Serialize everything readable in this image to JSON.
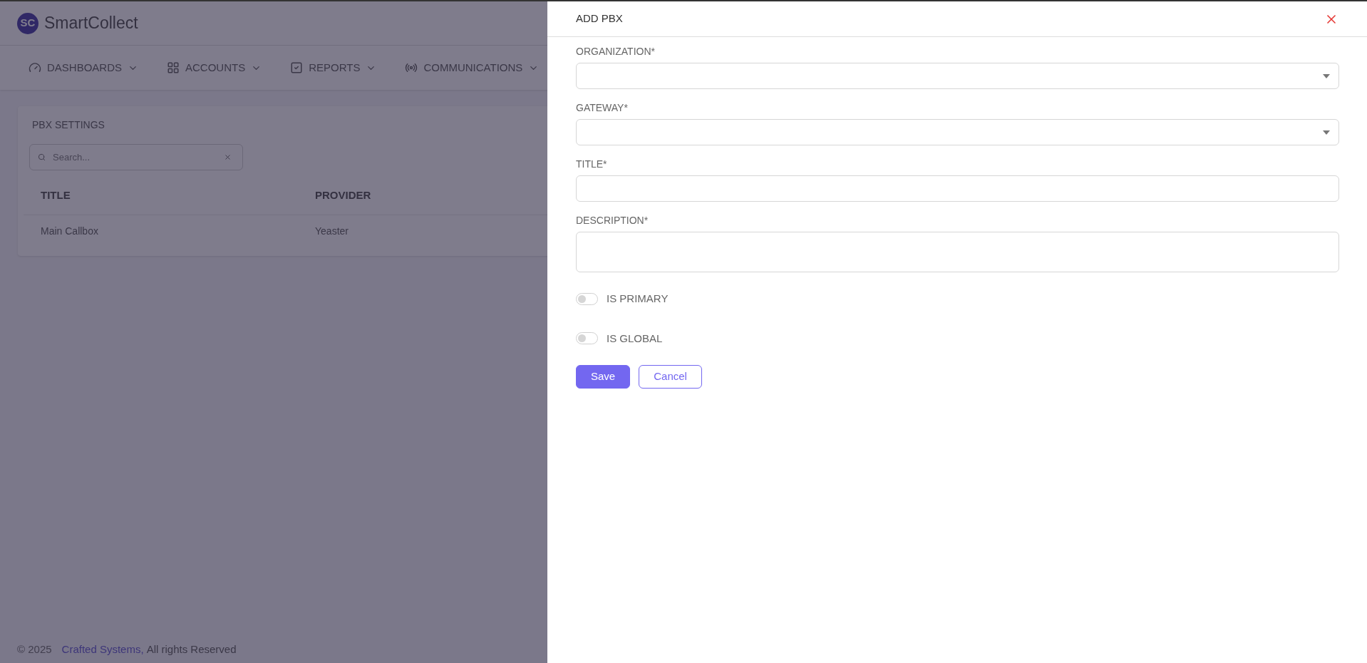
{
  "app": {
    "logo_text": "SC",
    "name": "SmartCollect"
  },
  "nav": [
    {
      "label": "DASHBOARDS"
    },
    {
      "label": "ACCOUNTS"
    },
    {
      "label": "REPORTS"
    },
    {
      "label": "COMMUNICATIONS"
    }
  ],
  "card": {
    "title": "PBX SETTINGS",
    "search": {
      "placeholder": "Search..."
    },
    "table": {
      "columns": [
        "TITLE",
        "PROVIDER"
      ],
      "rows": [
        [
          "Main Callbox",
          "Yeaster"
        ]
      ]
    }
  },
  "footer": {
    "copyright": "© 2025",
    "link": "Crafted Systems,",
    "rest": "All rights Reserved"
  },
  "drawer": {
    "title": "ADD PBX",
    "fields": [
      {
        "kind": "select",
        "label": "ORGANIZATION*"
      },
      {
        "kind": "select",
        "label": "GATEWAY*"
      },
      {
        "kind": "text",
        "label": "TITLE*"
      },
      {
        "kind": "textarea",
        "label": "DESCRIPTION*"
      }
    ],
    "toggles": [
      {
        "label": "IS PRIMARY",
        "on": false
      },
      {
        "label": "IS GLOBAL",
        "on": false
      }
    ],
    "buttons": [
      {
        "label": "Save",
        "kind": "primary"
      },
      {
        "label": "Cancel",
        "kind": "outline"
      }
    ]
  }
}
